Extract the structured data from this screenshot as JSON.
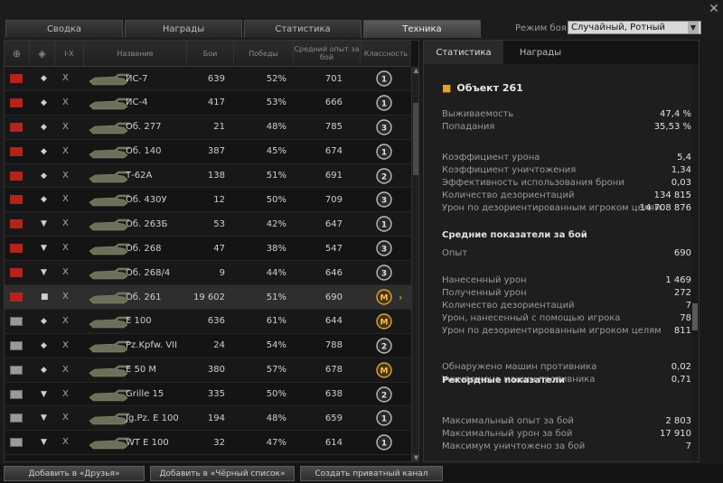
{
  "tabs": [
    "Сводка",
    "Награды",
    "Статистика",
    "Техника"
  ],
  "active_tab": 3,
  "battle_mode": {
    "label": "Режим боя:",
    "value": "Случайный, Ротный"
  },
  "close_glyph": "✕",
  "table": {
    "headers": {
      "nation": "⊕",
      "type": "◈",
      "tier": "I-X",
      "name": "Название",
      "battles": "Бои",
      "wins": "Победы",
      "avg_xp": "Средний опыт за бой",
      "mastery": "Классность"
    },
    "rows": [
      {
        "nation": "ussr",
        "rank_glyph": "◆",
        "tier": "X",
        "name": "ИС-7",
        "battles": "639",
        "wins": "52%",
        "avg_xp": "701",
        "mastery": "1"
      },
      {
        "nation": "ussr",
        "rank_glyph": "◆",
        "tier": "X",
        "name": "ИС-4",
        "battles": "417",
        "wins": "53%",
        "avg_xp": "666",
        "mastery": "1"
      },
      {
        "nation": "ussr",
        "rank_glyph": "◆",
        "tier": "X",
        "name": "Об. 277",
        "battles": "21",
        "wins": "48%",
        "avg_xp": "785",
        "mastery": "3"
      },
      {
        "nation": "ussr",
        "rank_glyph": "◆",
        "tier": "X",
        "name": "Об. 140",
        "battles": "387",
        "wins": "45%",
        "avg_xp": "674",
        "mastery": "1"
      },
      {
        "nation": "ussr",
        "rank_glyph": "◆",
        "tier": "X",
        "name": "Т-62А",
        "battles": "138",
        "wins": "51%",
        "avg_xp": "691",
        "mastery": "2"
      },
      {
        "nation": "ussr",
        "rank_glyph": "◆",
        "tier": "X",
        "name": "Об. 430У",
        "battles": "12",
        "wins": "50%",
        "avg_xp": "709",
        "mastery": "3"
      },
      {
        "nation": "ussr",
        "rank_glyph": "▼",
        "tier": "X",
        "name": "Об. 263Б",
        "battles": "53",
        "wins": "42%",
        "avg_xp": "647",
        "mastery": "1"
      },
      {
        "nation": "ussr",
        "rank_glyph": "▼",
        "tier": "X",
        "name": "Об. 268",
        "battles": "47",
        "wins": "38%",
        "avg_xp": "547",
        "mastery": "3"
      },
      {
        "nation": "ussr",
        "rank_glyph": "▼",
        "tier": "X",
        "name": "Об. 268/4",
        "battles": "9",
        "wins": "44%",
        "avg_xp": "646",
        "mastery": "3"
      },
      {
        "nation": "ussr",
        "rank_glyph": "■",
        "tier": "X",
        "name": "Об. 261",
        "battles": "19 602",
        "wins": "51%",
        "avg_xp": "690",
        "mastery": "M",
        "selected": true
      },
      {
        "nation": "de",
        "rank_glyph": "◆",
        "tier": "X",
        "name": "E 100",
        "battles": "636",
        "wins": "61%",
        "avg_xp": "644",
        "mastery": "M"
      },
      {
        "nation": "de",
        "rank_glyph": "◆",
        "tier": "X",
        "name": "Pz.Kpfw. VII",
        "battles": "24",
        "wins": "54%",
        "avg_xp": "788",
        "mastery": "2"
      },
      {
        "nation": "de",
        "rank_glyph": "◆",
        "tier": "X",
        "name": "E 50 M",
        "battles": "380",
        "wins": "57%",
        "avg_xp": "678",
        "mastery": "M"
      },
      {
        "nation": "de",
        "rank_glyph": "▼",
        "tier": "X",
        "name": "Grille 15",
        "battles": "335",
        "wins": "50%",
        "avg_xp": "638",
        "mastery": "2"
      },
      {
        "nation": "de",
        "rank_glyph": "▼",
        "tier": "X",
        "name": "Jg.Pz. E 100",
        "battles": "194",
        "wins": "48%",
        "avg_xp": "659",
        "mastery": "1"
      },
      {
        "nation": "de",
        "rank_glyph": "▼",
        "tier": "X",
        "name": "WT E 100",
        "battles": "32",
        "wins": "47%",
        "avg_xp": "614",
        "mastery": "1"
      }
    ]
  },
  "right": {
    "tabs": [
      "Статистика",
      "Награды"
    ],
    "vehicle": "Объект 261",
    "group1": [
      {
        "label": "Выживаемость",
        "value": "47,4 %"
      },
      {
        "label": "Попадания",
        "value": "35,53 %"
      }
    ],
    "group2": [
      {
        "label": "Коэффициент урона",
        "value": "5,4"
      },
      {
        "label": "Коэффициент уничтожения",
        "value": "1,34"
      },
      {
        "label": "Эффективность использования брони",
        "value": "0,03"
      },
      {
        "label": "Количество дезориентаций",
        "value": "134 815"
      },
      {
        "label": "Урон по дезориентированным игроком целям",
        "value": "14 708 876"
      }
    ],
    "avg_header": "Средние показатели за бой",
    "group3": [
      {
        "label": "Опыт",
        "value": "690"
      }
    ],
    "group4": [
      {
        "label": "Нанесенный урон",
        "value": "1 469"
      },
      {
        "label": "Полученный урон",
        "value": "272"
      },
      {
        "label": "Количество дезориентаций",
        "value": "7"
      },
      {
        "label": "Урон, нанесенный с помощью игрока",
        "value": "78"
      },
      {
        "label": "Урон по дезориентированным игроком целям",
        "value": "811"
      }
    ],
    "group5": [
      {
        "label": "Обнаружено машин противника",
        "value": "0,02"
      },
      {
        "label": "Уничтожено машин противника",
        "value": "0,71"
      }
    ],
    "record_header": "Рекордные показатели",
    "group6": [
      {
        "label": "Максимальный опыт за бой",
        "value": "2 803"
      },
      {
        "label": "Максимальный урон за бой",
        "value": "17 910"
      },
      {
        "label": "Максимум уничтожено за бой",
        "value": "7"
      }
    ]
  },
  "buttons": {
    "add_friend": "Добавить в «Друзья»",
    "add_blacklist": "Добавить в «Чёрный список»",
    "private_channel": "Создать приватный канал"
  }
}
